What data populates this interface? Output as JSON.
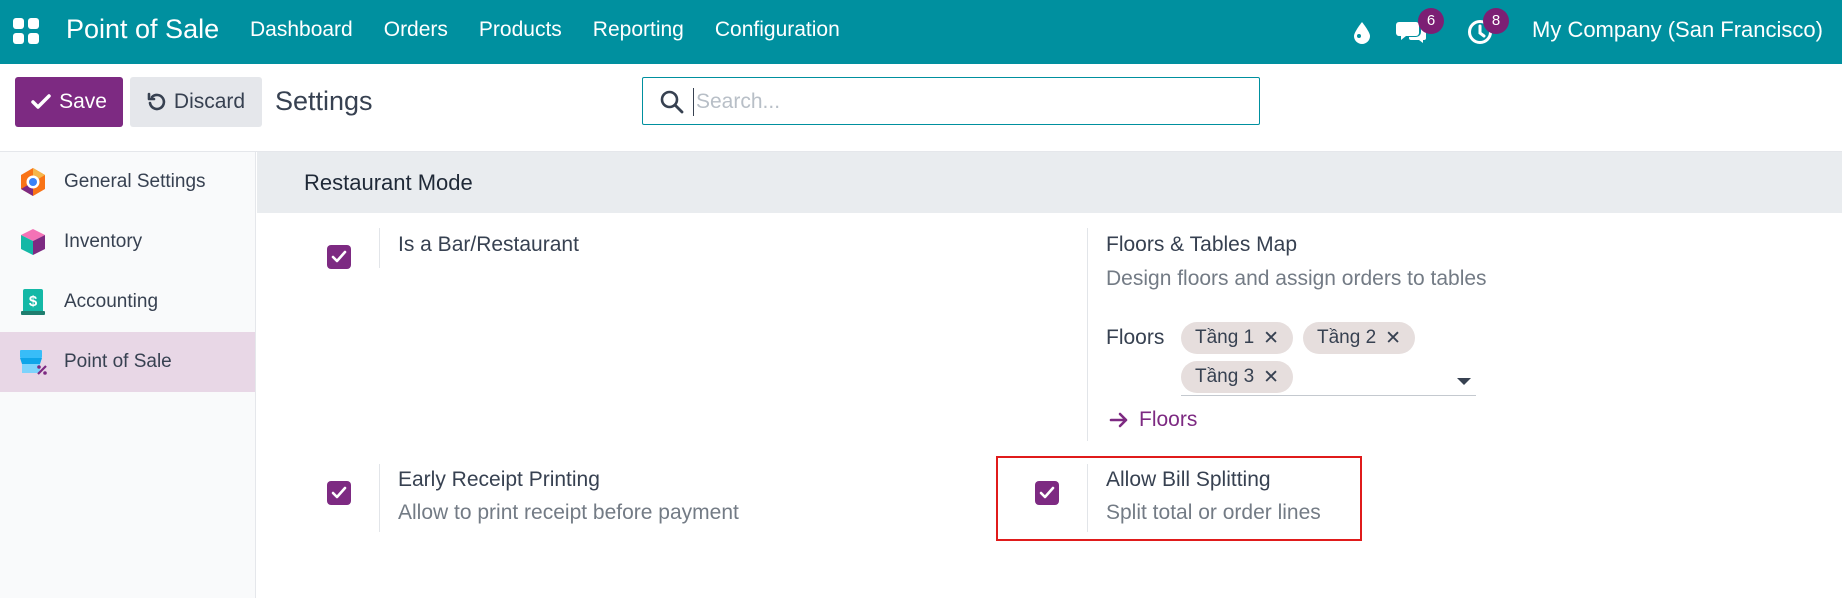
{
  "navbar": {
    "brand": "Point of Sale",
    "menu": [
      "Dashboard",
      "Orders",
      "Products",
      "Reporting",
      "Configuration"
    ],
    "messages_badge": "6",
    "activities_badge": "8",
    "company": "My Company (San Francisco)",
    "icons": [
      "apps-icon",
      "drop-icon",
      "chat-icon",
      "clock-icon"
    ]
  },
  "control": {
    "save_label": "Save",
    "discard_label": "Discard",
    "title": "Settings",
    "search_placeholder": "Search..."
  },
  "sidebar": {
    "items": [
      {
        "label": "General Settings",
        "icon": "general-settings-icon"
      },
      {
        "label": "Inventory",
        "icon": "inventory-icon"
      },
      {
        "label": "Accounting",
        "icon": "accounting-icon"
      },
      {
        "label": "Point of Sale",
        "icon": "point-of-sale-icon",
        "active": true
      }
    ]
  },
  "section": {
    "title": "Restaurant Mode",
    "options": {
      "bar_restaurant": {
        "title": "Is a Bar/Restaurant",
        "checked": true
      },
      "floors_tables": {
        "title": "Floors & Tables Map",
        "description": "Design floors and assign orders to tables",
        "floors_label": "Floors",
        "tags": [
          "Tầng 1",
          "Tầng 2",
          "Tầng 3"
        ],
        "link_label": "Floors"
      },
      "early_receipt": {
        "title": "Early Receipt Printing",
        "description": "Allow to print receipt before payment",
        "checked": true
      },
      "bill_splitting": {
        "title": "Allow Bill Splitting",
        "description": "Split total or order lines",
        "checked": true
      }
    }
  },
  "colors": {
    "navbar": "#00909f",
    "primary": "#7d2a82",
    "highlight": "#e01b1b"
  }
}
